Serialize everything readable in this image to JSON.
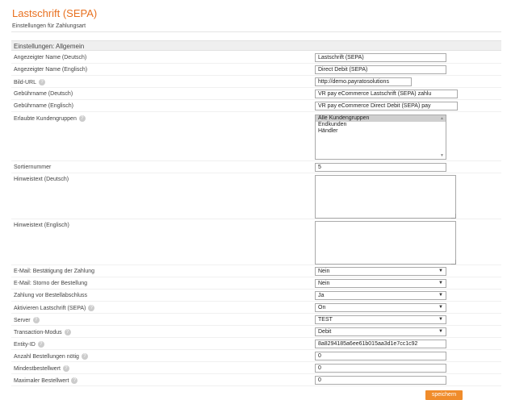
{
  "header": {
    "title": "Lastschrift (SEPA)",
    "subtitle": "Einstellungen für Zahlungsart"
  },
  "section": {
    "title": "Einstellungen: Allgemein"
  },
  "fields": {
    "name_de": {
      "label": "Angezeigter Name (Deutsch)",
      "value": "Lastschrift (SEPA)"
    },
    "name_en": {
      "label": "Angezeigter Name (Englisch)",
      "value": "Direct Debit (SEPA)"
    },
    "image_url": {
      "label": "Bild-URL",
      "value": "http://demo.payratosolutions"
    },
    "fee_name_de": {
      "label": "Gebührname (Deutsch)",
      "value": "VR pay eCommerce Lastschrift (SEPA) zahlu"
    },
    "fee_name_en": {
      "label": "Gebührname (Englisch)",
      "value": "VR pay eCommerce Direct Debit (SEPA) pay"
    },
    "customer_groups": {
      "label": "Erlaubte Kundengruppen",
      "options": [
        "Alle Kundengruppen",
        "Endkunden",
        "Händler"
      ],
      "selected": "Alle Kundengruppen"
    },
    "sort_number": {
      "label": "Sortiernummer",
      "value": "5"
    },
    "hint_de": {
      "label": "Hinweistext (Deutsch)",
      "value": ""
    },
    "hint_en": {
      "label": "Hinweistext (Englisch)",
      "value": ""
    },
    "email_confirm": {
      "label": "E-Mail: Bestätigung der Zahlung",
      "value": "Nein"
    },
    "email_cancel": {
      "label": "E-Mail: Storno der Bestellung",
      "value": "Nein"
    },
    "pay_before": {
      "label": "Zahlung vor Bestellabschluss",
      "value": "Ja"
    },
    "activate": {
      "label": "Aktivieren Lastschrift (SEPA)",
      "value": "On"
    },
    "server": {
      "label": "Server",
      "value": "TEST"
    },
    "transaction_mode": {
      "label": "Transaction-Modus",
      "value": "Debit"
    },
    "entity_id": {
      "label": "Entity-ID",
      "value": "8a8294185a6ee61b015aa3d1e7cc1c92"
    },
    "order_count": {
      "label": "Anzahl Bestellungen nötig",
      "value": "0"
    },
    "min_order": {
      "label": "Mindestbestellwert",
      "value": "0"
    },
    "max_order": {
      "label": "Maximaler Bestellwert",
      "value": "0"
    }
  },
  "actions": {
    "save_label": "speichern"
  },
  "icons": {
    "help": "help-circle-icon",
    "dropdown": "chevron-down-icon"
  },
  "colors": {
    "title": "#e8701f",
    "save_button": "#f08c2b",
    "section_bg": "#efefef"
  }
}
